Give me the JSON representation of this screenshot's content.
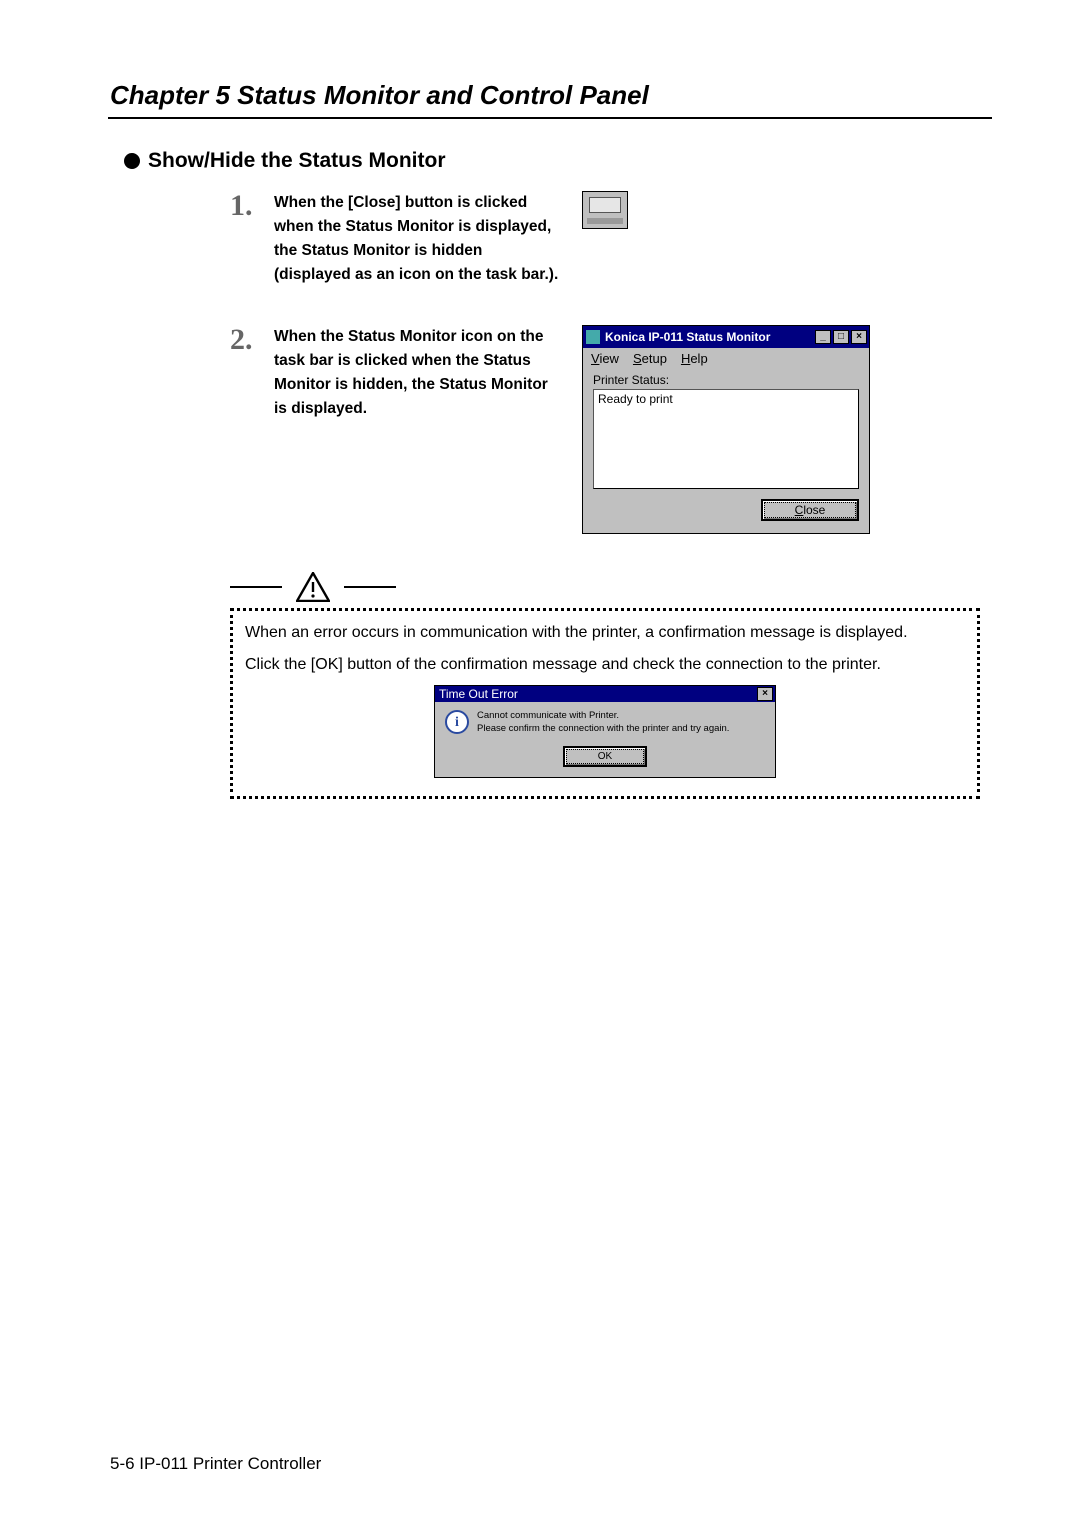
{
  "chapter_title": "Chapter 5 Status Monitor and Control Panel",
  "section_title": "Show/Hide the Status Monitor",
  "steps": {
    "one_num": "1.",
    "one_text": "When the [Close] button is clicked when the Status Monitor is displayed, the Status Monitor is hidden\n(displayed as an icon on the task bar.).",
    "two_num": "2.",
    "two_text": "When the Status Monitor icon on the task bar is clicked when the Status Monitor is hidden, the Status Monitor is displayed."
  },
  "status_window": {
    "title": "Konica IP-011 Status Monitor",
    "menu": {
      "view": "View",
      "setup": "Setup",
      "help": "Help"
    },
    "status_label": "Printer Status:",
    "status_value": "Ready to print",
    "close_label": "Close",
    "min_glyph": "_",
    "max_glyph": "□",
    "x_glyph": "×"
  },
  "note": {
    "line1": "When an error occurs in communication with the printer, a confirmation message is displayed.",
    "line2": "Click the [OK] button of the confirmation message and check the connection to the printer."
  },
  "error_dialog": {
    "title": "Time Out Error",
    "msg1": "Cannot communicate with Printer.",
    "msg2": "Please confirm the connection with the printer and try again.",
    "ok_label": "OK",
    "info_glyph": "i",
    "x_glyph": "×"
  },
  "footer": "5-6  IP-011 Printer Controller"
}
